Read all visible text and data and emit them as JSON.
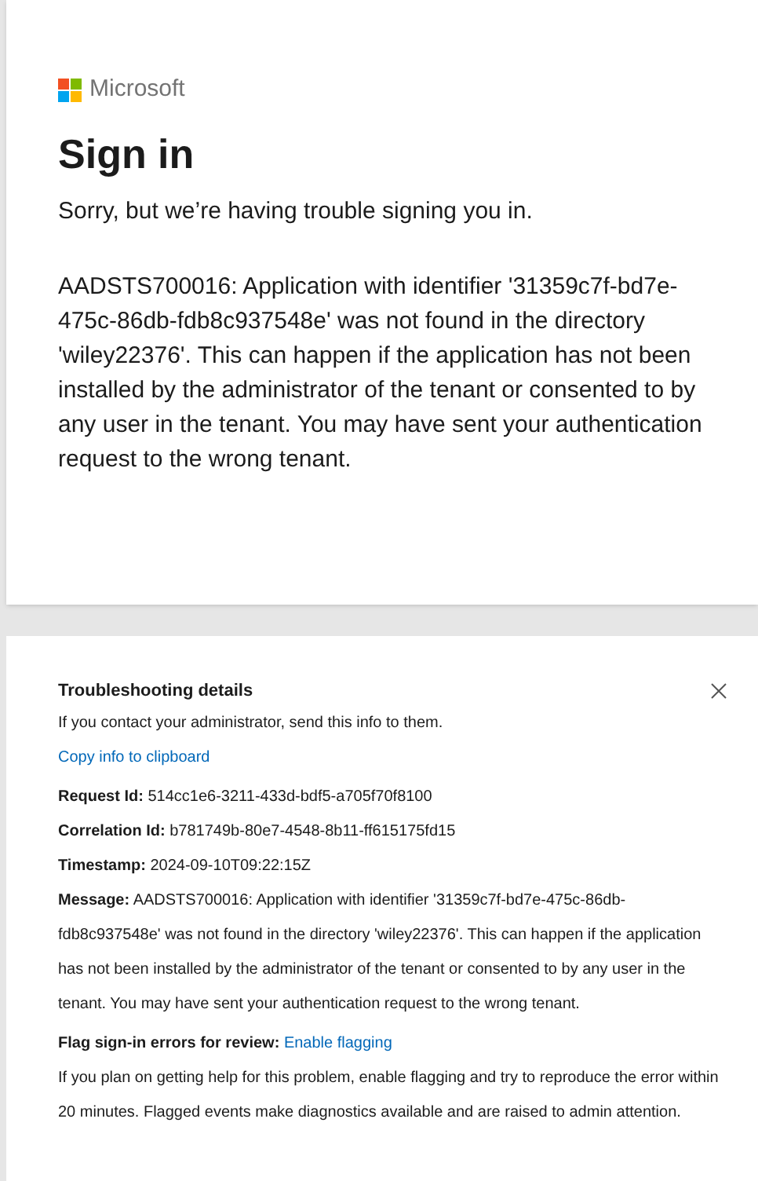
{
  "brand": {
    "name": "Microsoft"
  },
  "title": "Sign in",
  "subtitle": "Sorry, but we’re having trouble signing you in.",
  "error": "AADSTS700016: Application with identifier '31359c7f-bd7e-475c-86db-fdb8c937548e' was not found in the directory 'wiley22376'. This can happen if the application has not been installed by the administrator of the tenant or consented to by any user in the tenant. You may have sent your authentication request to the wrong tenant.",
  "troubleshooting": {
    "title": "Troubleshooting details",
    "intro": "If you contact your administrator, send this info to them.",
    "copy_link": "Copy info to clipboard",
    "details": [
      {
        "label": "Request Id:",
        "value": "514cc1e6-3211-433d-bdf5-a705f70f8100"
      },
      {
        "label": "Correlation Id:",
        "value": "b781749b-80e7-4548-8b11-ff615175fd15"
      },
      {
        "label": "Timestamp:",
        "value": "2024-09-10T09:22:15Z"
      },
      {
        "label": "Message:",
        "value": "AADSTS700016: Application with identifier '31359c7f-bd7e-475c-86db-fdb8c937548e' was not found in the directory 'wiley22376'. This can happen if the application has not been installed by the administrator of the tenant or consented to by any user in the tenant. You may have sent your authentication request to the wrong tenant."
      }
    ],
    "flag_label": "Flag sign-in errors for review:",
    "flag_link": "Enable flagging",
    "flag_help": "If you plan on getting help for this problem, enable flagging and try to reproduce the error within 20 minutes. Flagged events make diagnostics available and are raised to admin attention."
  }
}
